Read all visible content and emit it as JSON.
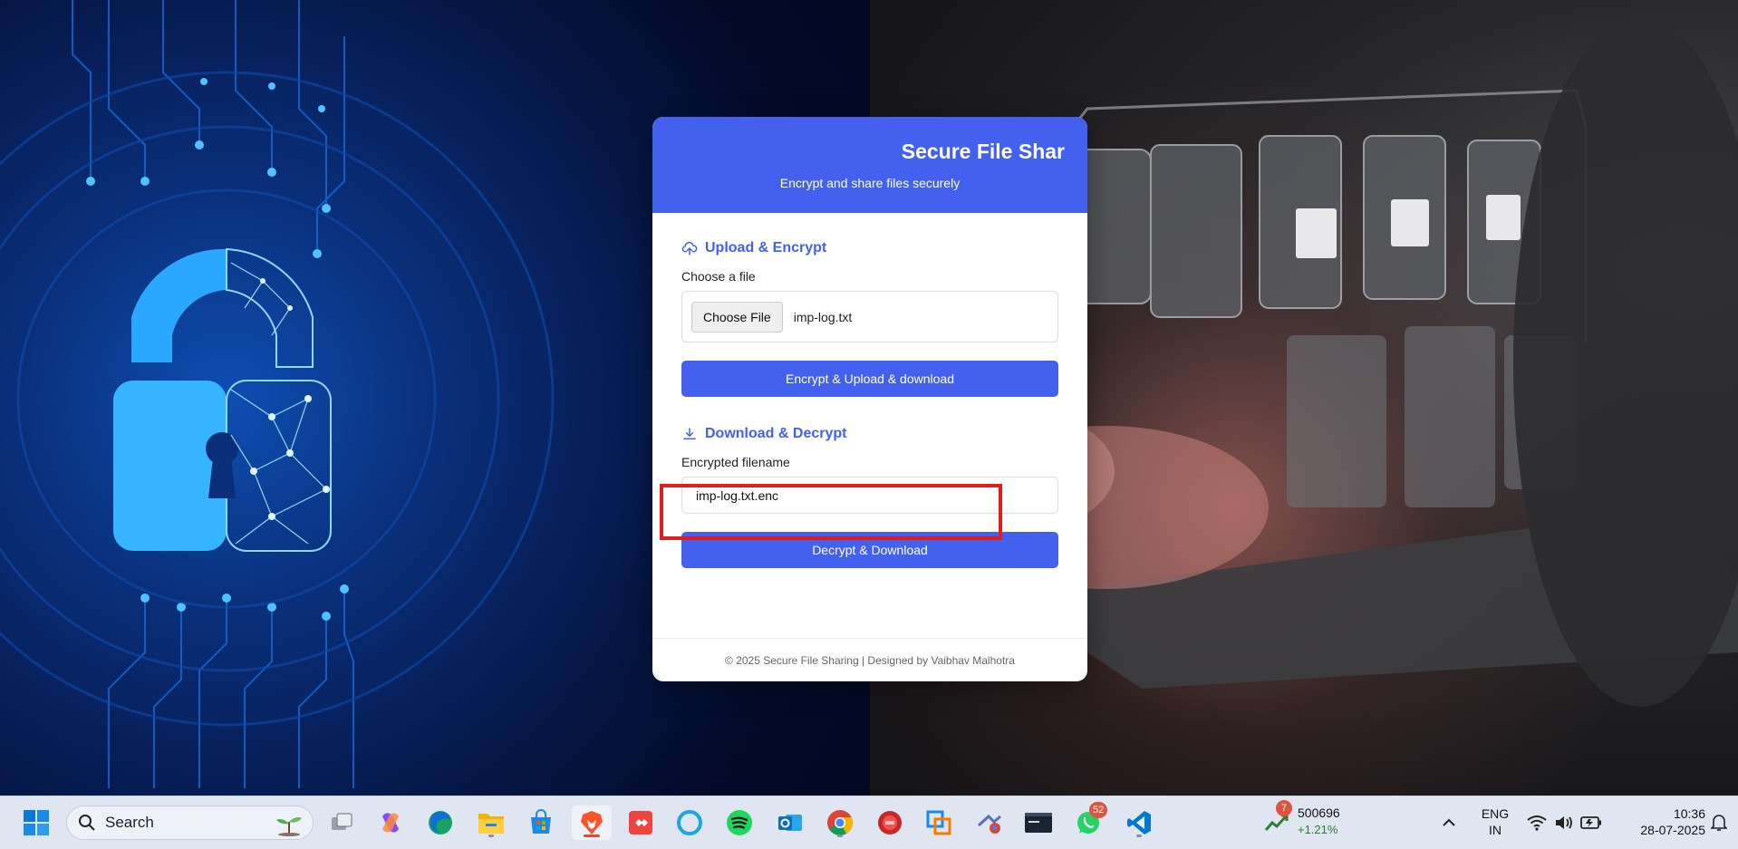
{
  "app": {
    "title": "Secure File Shar",
    "subtitle": "Encrypt and share files securely"
  },
  "upload": {
    "section_title": "Upload & Encrypt",
    "field_label": "Choose a file",
    "choose_button": "Choose File",
    "selected_file": "imp-log.txt",
    "submit_label": "Encrypt & Upload & download"
  },
  "download": {
    "section_title": "Download & Decrypt",
    "field_label": "Encrypted filename",
    "input_value": "imp-log.txt.enc",
    "submit_label": "Decrypt & Download"
  },
  "footer": {
    "text": "© 2025 Secure File Sharing | Designed by Vaibhav Malhotra"
  },
  "colors": {
    "accent": "#4361ee",
    "highlight": "#e01e1e"
  },
  "taskbar": {
    "search_label": "Search",
    "apps": [
      "windows-start-icon",
      "task-view-icon",
      "copilot-icon",
      "edge-icon",
      "file-explorer-icon",
      "store-icon",
      "brave-icon",
      "anydesk-icon",
      "alexa-icon",
      "spotify-icon",
      "outlook-icon",
      "chrome-icon",
      "record-icon",
      "virtualbox-icon",
      "chrome-profile-icon",
      "mysql-icon",
      "whatsapp-icon",
      "vscode-icon"
    ],
    "whatsapp_badge": "52",
    "stock": {
      "badge": "7",
      "value": "500696",
      "change": "+1.21%"
    },
    "language": {
      "line1": "ENG",
      "line2": "IN"
    },
    "clock": {
      "time": "10:36",
      "date": "28-07-2025"
    }
  }
}
